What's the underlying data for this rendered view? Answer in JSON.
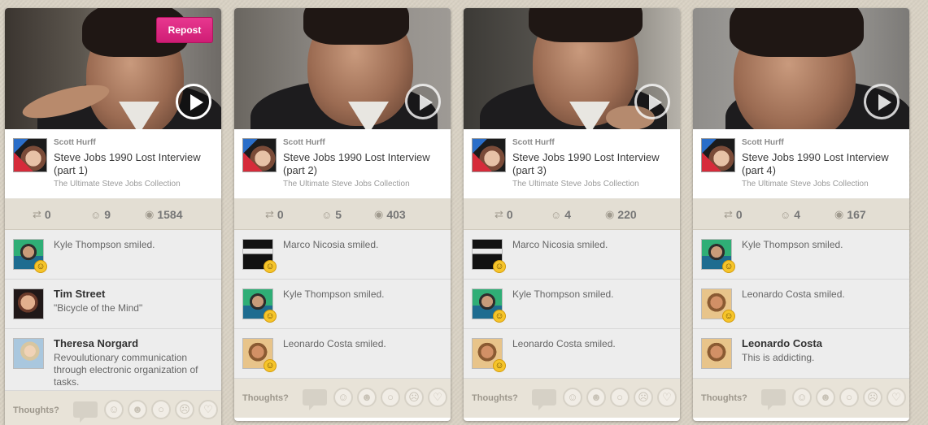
{
  "cards": [
    {
      "repost_label": "Repost",
      "author": "Scott Hurff",
      "title": "Steve Jobs 1990 Lost Interview (part 1)",
      "collection": "The Ultimate Steve Jobs Collection",
      "stats": {
        "reposts": "0",
        "smiles": "9",
        "views": "1584"
      },
      "activity": [
        {
          "type": "smile",
          "text": "Kyle Thompson smiled.",
          "avatar": "kyle"
        },
        {
          "type": "comment",
          "name": "Tim Street",
          "comment": "\"Bicycle of the Mind\"",
          "avatar": "tim"
        },
        {
          "type": "comment",
          "name": "Theresa Norgard",
          "comment": "Revoulutionary communication through electronic organization of tasks.",
          "avatar": "theresa"
        }
      ],
      "thoughts_label": "Thoughts?"
    },
    {
      "author": "Scott Hurff",
      "title": "Steve Jobs 1990 Lost Interview (part 2)",
      "collection": "The Ultimate Steve Jobs Collection",
      "stats": {
        "reposts": "0",
        "smiles": "5",
        "views": "403"
      },
      "activity": [
        {
          "type": "smile",
          "text": "Marco Nicosia smiled.",
          "avatar": "marco"
        },
        {
          "type": "smile",
          "text": "Kyle Thompson smiled.",
          "avatar": "kyle"
        },
        {
          "type": "smile",
          "text": "Leonardo Costa smiled.",
          "avatar": "leonardo"
        }
      ],
      "thoughts_label": "Thoughts?"
    },
    {
      "author": "Scott Hurff",
      "title": "Steve Jobs 1990 Lost Interview (part 3)",
      "collection": "The Ultimate Steve Jobs Collection",
      "stats": {
        "reposts": "0",
        "smiles": "4",
        "views": "220"
      },
      "activity": [
        {
          "type": "smile",
          "text": "Marco Nicosia smiled.",
          "avatar": "marco"
        },
        {
          "type": "smile",
          "text": "Kyle Thompson smiled.",
          "avatar": "kyle"
        },
        {
          "type": "smile",
          "text": "Leonardo Costa smiled.",
          "avatar": "leonardo"
        }
      ],
      "thoughts_label": "Thoughts?"
    },
    {
      "author": "Scott Hurff",
      "title": "Steve Jobs 1990 Lost Interview (part 4)",
      "collection": "The Ultimate Steve Jobs Collection",
      "stats": {
        "reposts": "0",
        "smiles": "4",
        "views": "167"
      },
      "activity": [
        {
          "type": "smile",
          "text": "Kyle Thompson smiled.",
          "avatar": "kyle"
        },
        {
          "type": "smile",
          "text": "Leonardo Costa smiled.",
          "avatar": "leonardo"
        },
        {
          "type": "comment",
          "name": "Leonardo Costa",
          "comment": "This is addicting.",
          "avatar": "leonardo"
        }
      ],
      "thoughts_label": "Thoughts?"
    }
  ],
  "icons": {
    "repost": "repost-icon",
    "smile": "smile-icon",
    "views": "eye-icon",
    "play": "play-icon",
    "reaction_icons": [
      "smile-reaction-icon",
      "laugh-reaction-icon",
      "surprised-reaction-icon",
      "sad-reaction-icon",
      "heart-reaction-icon"
    ]
  },
  "colors": {
    "accent": "#d9267f",
    "background": "#d9d2c4"
  }
}
